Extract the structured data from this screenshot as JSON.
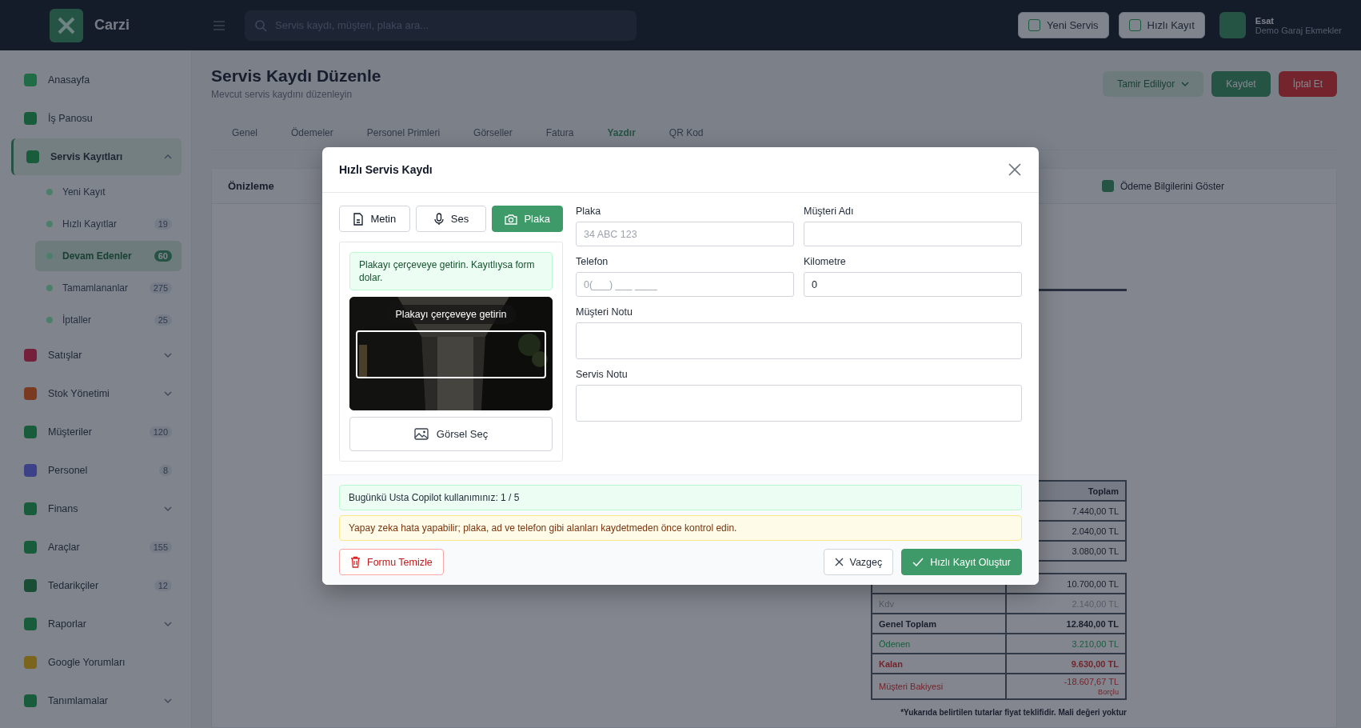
{
  "app": {
    "logo": "Carzi",
    "search": {
      "placeholder": "Servis kaydı, müşteri, plaka ara..."
    },
    "buttons": [
      "Yeni Servis",
      "Hızlı Kayıt"
    ],
    "user": {
      "name": "Esat",
      "company": "Demo Garaj Ekmekler"
    }
  },
  "sidebar": {
    "items": [
      {
        "label": "Anasayfa",
        "selected": false
      },
      {
        "label": "İş Panosu",
        "selected": false
      },
      {
        "label": "Servis Kayıtları",
        "selected": true,
        "expanded": true,
        "children": [
          {
            "label": "Yeni Kayıt",
            "selected": false
          },
          {
            "label": "Hızlı Kayıtlar",
            "count": "19",
            "selected": false
          },
          {
            "label": "Devam Edenler",
            "count": "60",
            "selected": true
          },
          {
            "label": "Tamamlananlar",
            "count": "275",
            "selected": false
          },
          {
            "label": "İptaller",
            "count": "25",
            "selected": false
          }
        ]
      },
      {
        "label": "Satışlar",
        "selected": false,
        "expanded": false
      },
      {
        "label": "Stok Yönetimi",
        "selected": false,
        "expanded": false
      },
      {
        "label": "Müşteriler",
        "count": "120",
        "selected": false
      },
      {
        "label": "Personel",
        "count": "8",
        "selected": false
      },
      {
        "label": "Finans",
        "selected": false,
        "expanded": false
      },
      {
        "label": "Araçlar",
        "count": "155",
        "selected": false
      },
      {
        "label": "Tedarikçiler",
        "count": "12",
        "selected": false
      },
      {
        "label": "Raporlar",
        "selected": false,
        "expanded": false
      },
      {
        "label": "Google Yorumları",
        "selected": false
      },
      {
        "label": "Tanımlamalar",
        "selected": false,
        "expanded": false
      }
    ]
  },
  "page": {
    "title": "Servis Kaydı Düzenle",
    "subtitle": "Mevcut servis kaydını düzenleyin",
    "status": "Tamir Ediliyor",
    "save": "Kaydet",
    "cancel": "İptal Et",
    "tabs": [
      {
        "label": "Genel",
        "selected": false
      },
      {
        "label": "Ödemeler",
        "selected": false
      },
      {
        "label": "Personel Primleri",
        "selected": false
      },
      {
        "label": "Görseller",
        "selected": false
      },
      {
        "label": "Fatura",
        "selected": false
      },
      {
        "label": "Yazdır",
        "selected": true
      },
      {
        "label": "QR Kod",
        "selected": false
      }
    ],
    "preview": {
      "title": "Önizleme",
      "option": {
        "label": "Ödeme Bilgilerini Göster",
        "checked": true
      },
      "totals_header": "Toplam",
      "totals": [
        {
          "value": "7.440,00 TL"
        },
        {
          "value": "2.040,00 TL"
        },
        {
          "value": "3.080,00 TL"
        }
      ],
      "summary": [
        {
          "value": "10.700,00 TL",
          "kind": "plain"
        },
        {
          "label": "Kdv",
          "value": "2.140,00 TL",
          "kind": "muted"
        },
        {
          "label": "Genel Toplam",
          "value": "12.840,00 TL",
          "kind": "bold"
        },
        {
          "label": "Ödenen",
          "value": "3.210,00 TL",
          "kind": "paid"
        },
        {
          "label": "Kalan",
          "value": "9.630,00 TL",
          "kind": "due"
        },
        {
          "label": "Müşteri Bakiyesi",
          "value": "-18.607,67 TL",
          "note": "Borçlu",
          "kind": "debt"
        }
      ],
      "footnote": "*Yukarıda belirtilen tutarlar fiyat teklifidir. Mali değeri yoktur"
    }
  },
  "modal": {
    "title": "Hızlı Servis Kaydı",
    "modes": [
      {
        "label": "Metin",
        "kind": "text",
        "selected": false
      },
      {
        "label": "Ses",
        "kind": "voice",
        "selected": false
      },
      {
        "label": "Plaka",
        "kind": "camera",
        "selected": true
      }
    ],
    "hint": "Plakayı çerçeveye getirin. Kayıtlıysa form dolar.",
    "camera_label": "Plakayı çerçeveye getirin",
    "pick_image": "Görsel Seç",
    "fields": [
      {
        "label": "Plaka",
        "placeholder": "34 ABC 123",
        "kind": "input"
      },
      {
        "label": "Müşteri Adı",
        "kind": "input"
      },
      {
        "label": "Telefon",
        "placeholder": "0(___) ___ ____",
        "kind": "input"
      },
      {
        "label": "Kilometre",
        "value": "0",
        "kind": "input"
      },
      {
        "label": "Müşteri Notu",
        "kind": "textarea"
      },
      {
        "label": "Servis Notu",
        "kind": "textarea"
      }
    ],
    "notices": [
      {
        "text": "Bugünkü Usta Copilot kullanımınız: 1 / 5",
        "kind": "info"
      },
      {
        "text": "Yapay zeka hata yapabilir; plaka, ad ve telefon gibi alanları kaydetmeden önce kontrol edin.",
        "kind": "warning"
      }
    ],
    "clear": "Formu Temizle",
    "dismiss": "Vazgeç",
    "submit": "Hızlı Kayıt Oluştur"
  }
}
